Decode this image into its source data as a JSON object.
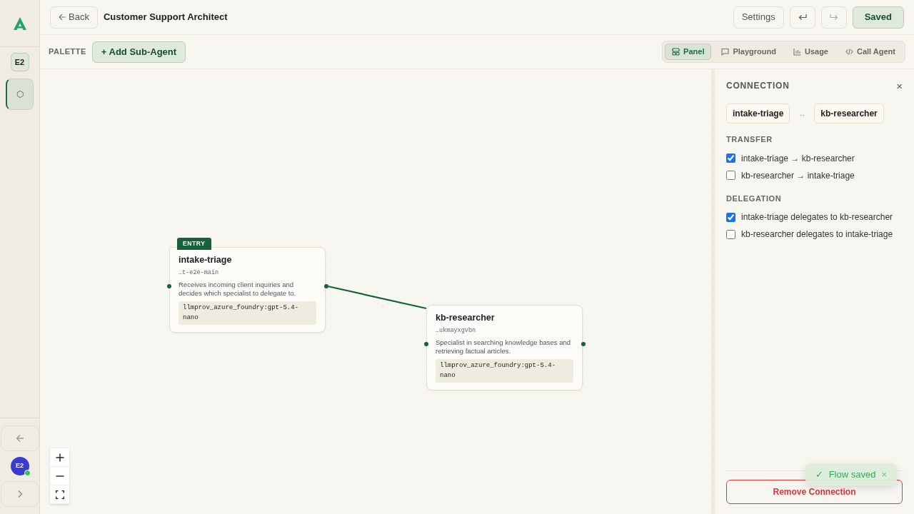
{
  "sidebar": {
    "workspace_badge": "E2",
    "nav_items": [
      {
        "glyph": "⬡",
        "selected": true
      }
    ],
    "avatar": {
      "initials": "E2",
      "online": true
    }
  },
  "header": {
    "back_label": "Back",
    "title": "Customer Support Architect",
    "settings_label": "Settings",
    "save_label": "Saved"
  },
  "toolbar": {
    "palette_label": "PALETTE",
    "add_label": "+ Add Sub-Agent",
    "view_tabs": [
      {
        "kind": "panel",
        "label": "Panel",
        "selected": true
      },
      {
        "kind": "playground",
        "label": "Playground",
        "selected": false
      },
      {
        "kind": "usage",
        "label": "Usage",
        "selected": false
      },
      {
        "kind": "code",
        "label": "Call Agent",
        "selected": false
      }
    ]
  },
  "canvas": {
    "nodes": [
      {
        "name": "intake-triage",
        "entry": true,
        "entry_label": "ENTRY",
        "id_suffix": "…t-e2e-main",
        "description": "Receives incoming client inquiries and decides which specialist to delegate to.",
        "model": "llmprov_azure_foundry:gpt-5.4-nano"
      },
      {
        "name": "kb-researcher",
        "entry": false,
        "id_suffix": "…ukmayxgvbn",
        "description": "Specialist in searching knowledge bases and retrieving factual articles.",
        "model": "llmprov_azure_foundry:gpt-5.4-nano"
      }
    ],
    "edges": [
      {
        "selected": true
      }
    ]
  },
  "panel": {
    "title": "CONNECTION",
    "close": "×",
    "source": "intake-triage",
    "link_glyph": "↔",
    "target": "kb-researcher",
    "sections": [
      {
        "title": "TRANSFER",
        "options": [
          {
            "label": "intake-triage → kb-researcher",
            "checked": true
          },
          {
            "label": "kb-researcher → intake-triage",
            "checked": false
          }
        ]
      },
      {
        "title": "DELEGATION",
        "options": [
          {
            "label": "intake-triage delegates to kb-researcher",
            "checked": true
          },
          {
            "label": "kb-researcher delegates to intake-triage",
            "checked": false
          }
        ]
      }
    ],
    "remove_label": "Remove Connection"
  },
  "toast": {
    "check": "✓",
    "message": "Flow saved",
    "close": "×"
  }
}
